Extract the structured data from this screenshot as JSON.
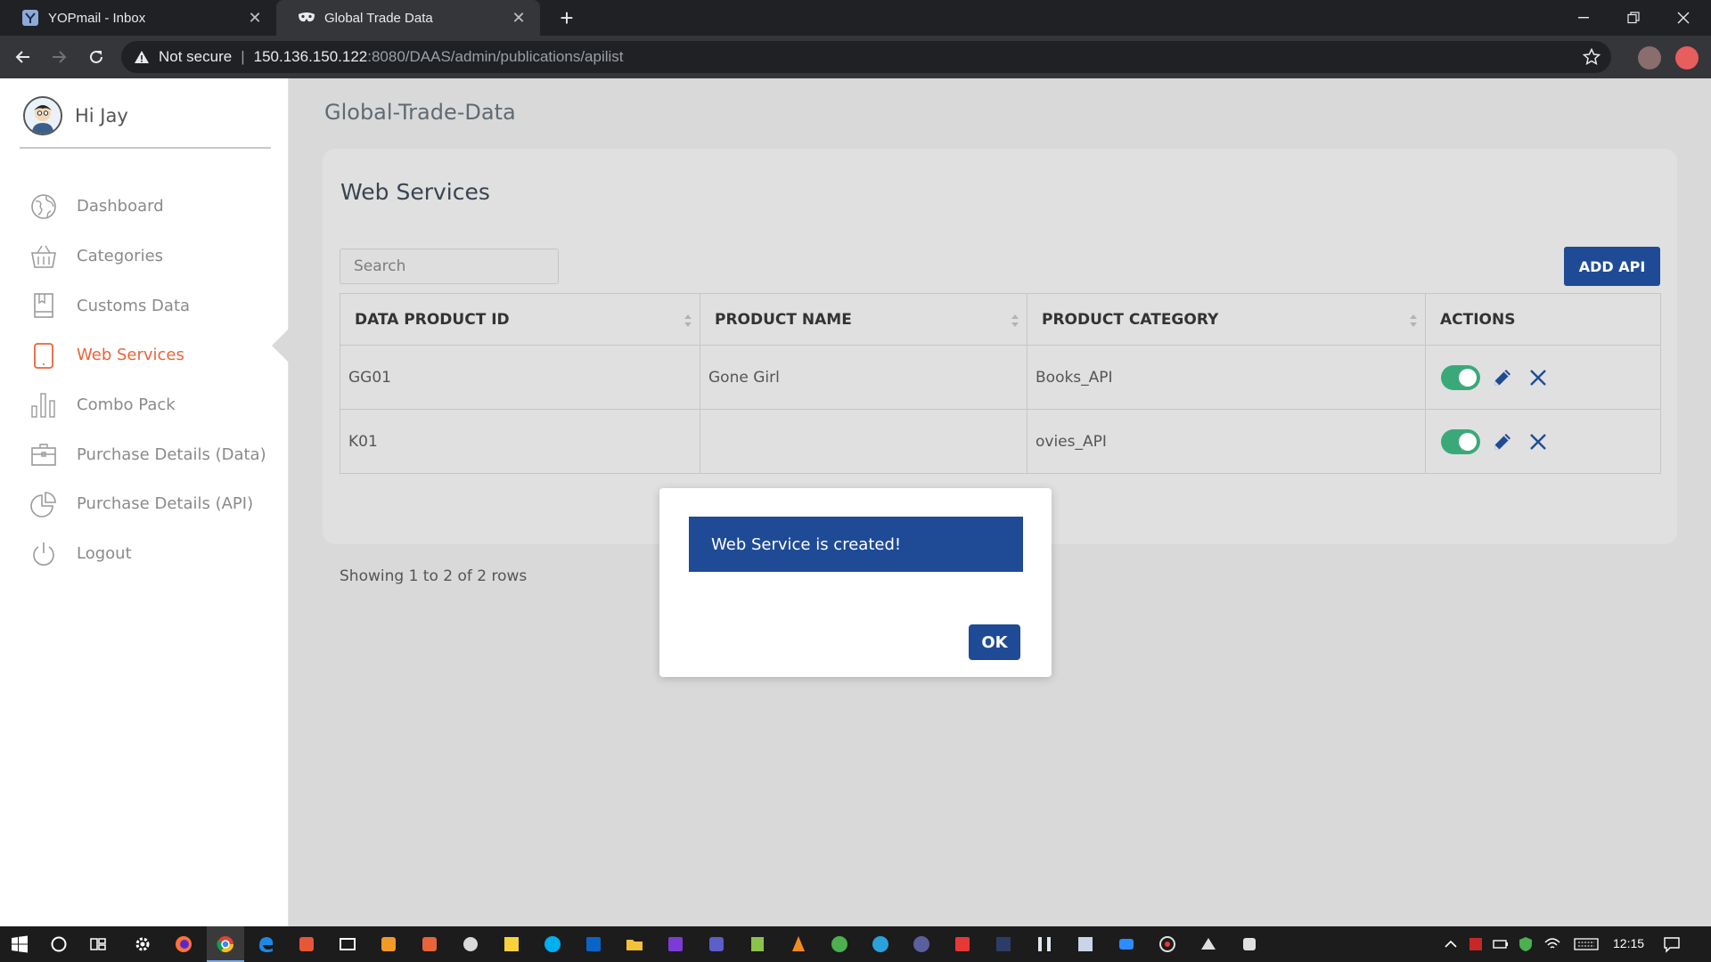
{
  "browser": {
    "tabs": [
      {
        "title": "YOPmail - Inbox",
        "icon": "yopmail-icon",
        "active": false
      },
      {
        "title": "Global Trade Data",
        "icon": "mask-icon",
        "active": true
      }
    ],
    "address": {
      "security": "Not secure",
      "host": "150.136.150.122",
      "path": ":8080/DAAS/admin/publications/apilist"
    }
  },
  "sidebar": {
    "greeting": "Hi Jay",
    "items": [
      {
        "label": "Dashboard",
        "icon": "globe-icon"
      },
      {
        "label": "Categories",
        "icon": "basket-icon"
      },
      {
        "label": "Customs Data",
        "icon": "book-icon"
      },
      {
        "label": "Web Services",
        "icon": "tablet-icon",
        "active": true
      },
      {
        "label": "Combo Pack",
        "icon": "bar-chart-icon"
      },
      {
        "label": "Purchase Details (Data)",
        "icon": "briefcase-icon"
      },
      {
        "label": "Purchase Details (API)",
        "icon": "pie-chart-icon"
      },
      {
        "label": "Logout",
        "icon": "power-icon"
      }
    ]
  },
  "main": {
    "site_title": "Global-Trade-Data",
    "card_title": "Web Services",
    "search_placeholder": "Search",
    "add_button": "ADD API",
    "table": {
      "columns": [
        "DATA PRODUCT ID",
        "PRODUCT NAME",
        "PRODUCT CATEGORY",
        "ACTIONS"
      ],
      "rows": [
        {
          "id": "GG01",
          "name": "Gone Girl",
          "category": "Books_API",
          "enabled": true
        },
        {
          "id": "K01",
          "name": "",
          "category": "ovies_API",
          "enabled": true
        }
      ]
    },
    "rows_info": "Showing 1 to 2 of 2 rows"
  },
  "modal": {
    "message": "Web Service is created!",
    "ok_label": "OK"
  },
  "taskbar": {
    "time": "12:15"
  },
  "colors": {
    "primary": "#1f4b96",
    "active_menu": "#e9643b",
    "toggle_on": "#3aa97a",
    "main_bg": "#d9d9d9"
  }
}
